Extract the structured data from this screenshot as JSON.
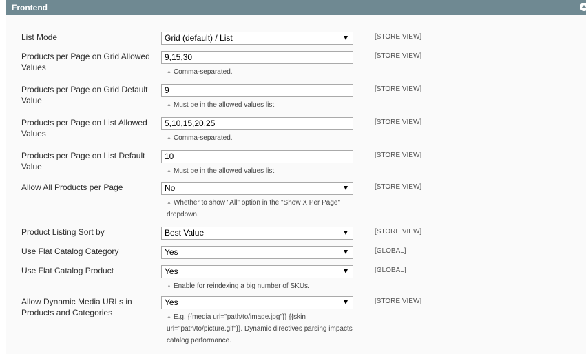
{
  "section": {
    "title": "Frontend"
  },
  "rows": [
    {
      "label": "List Mode",
      "type": "select",
      "value": "Grid (default) / List",
      "scope": "[STORE VIEW]"
    },
    {
      "label": "Products per Page on Grid Allowed Values",
      "type": "input",
      "value": "9,15,30",
      "note": "Comma-separated.",
      "scope": "[STORE VIEW]"
    },
    {
      "label": "Products per Page on Grid Default Value",
      "type": "input",
      "value": "9",
      "note": "Must be in the allowed values list.",
      "scope": "[STORE VIEW]"
    },
    {
      "label": "Products per Page on List Allowed Values",
      "type": "input",
      "value": "5,10,15,20,25",
      "note": "Comma-separated.",
      "scope": "[STORE VIEW]"
    },
    {
      "label": "Products per Page on List Default Value",
      "type": "input",
      "value": "10",
      "note": "Must be in the allowed values list.",
      "scope": "[STORE VIEW]"
    },
    {
      "label": "Allow All Products per Page",
      "type": "select",
      "value": "No",
      "note": "Whether to show \"All\" option in the \"Show X Per Page\" dropdown.",
      "scope": "[STORE VIEW]"
    },
    {
      "label": "Product Listing Sort by",
      "type": "select",
      "value": "Best Value",
      "scope": "[STORE VIEW]"
    },
    {
      "label": "Use Flat Catalog Category",
      "type": "select",
      "value": "Yes",
      "scope": "[GLOBAL]"
    },
    {
      "label": "Use Flat Catalog Product",
      "type": "select",
      "value": "Yes",
      "note": "Enable for reindexing a big number of SKUs.",
      "scope": "[GLOBAL]"
    },
    {
      "label": "Allow Dynamic Media URLs in Products and Categories",
      "type": "select",
      "value": "Yes",
      "note": "E.g. {{media url=\"path/to/image.jpg\"}} {{skin url=\"path/to/picture.gif\"}}. Dynamic directives parsing impacts catalog performance.",
      "scope": "[STORE VIEW]"
    }
  ]
}
